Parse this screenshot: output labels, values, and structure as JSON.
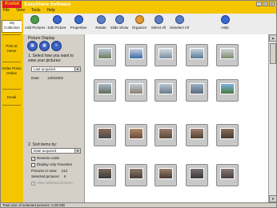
{
  "window": {
    "brand": "Kodak",
    "title": "EasyShare Software"
  },
  "menu": [
    "File",
    "View",
    "Tools",
    "Help"
  ],
  "sidebar": {
    "tabs": [
      "My Collection",
      "Print at Home",
      "Order Prints Online",
      "Email"
    ]
  },
  "toolbar": {
    "buttons": [
      {
        "label": "Add Pictures",
        "icon": "add-pictures-icon"
      },
      {
        "label": "Edit Picture",
        "icon": "edit-picture-icon"
      },
      {
        "label": "Properties",
        "icon": "properties-icon"
      },
      {
        "label": "Rotate",
        "icon": "rotate-icon"
      },
      {
        "label": "Slide Show",
        "icon": "slide-show-icon"
      },
      {
        "label": "Organize",
        "icon": "organize-icon"
      },
      {
        "label": "Select All",
        "icon": "select-all-icon"
      },
      {
        "label": "Deselect All",
        "icon": "deselect-all-icon"
      },
      {
        "label": "Help",
        "icon": "help-icon"
      }
    ]
  },
  "panel": {
    "title": "Picture Display",
    "step1": "1.  Select how you want to view your pictures:",
    "view_select": "Last acquired",
    "date_label": "Date:",
    "date_value": "12/5/2002",
    "step2": "2.  Sort items by:",
    "sort_select": "Date acquired",
    "reverse_order": "Reverse order",
    "display_favorites": "Display only Favorites",
    "pictures_in_view_label": "Pictures in view:",
    "pictures_in_view_value": "212",
    "selected_label": "Selected pictures:",
    "selected_value": "6",
    "view_selected": "View selected pictures"
  },
  "status": {
    "text": "Total size of selected pictures:  0.00 MB"
  },
  "colors": {
    "brand_yellow": "#f5c600",
    "brand_red": "#e31b23"
  }
}
